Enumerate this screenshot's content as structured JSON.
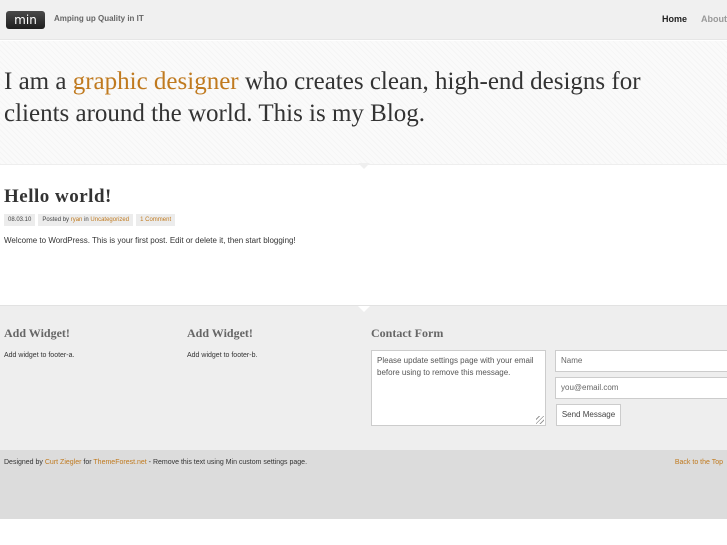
{
  "header": {
    "logo": "min",
    "tagline": "Amping up Quality in IT",
    "nav": [
      {
        "label": "Home",
        "active": true
      },
      {
        "label": "About",
        "active": false
      }
    ]
  },
  "hero": {
    "prefix": "I am a ",
    "highlight": "graphic designer",
    "suffix": " who creates clean, high-end designs for clients around the world. This is my Blog."
  },
  "post": {
    "title": "Hello world!",
    "date": "08.03.10",
    "posted_by_prefix": "Posted by",
    "author": "ryan",
    "in_label": "in",
    "category": "Uncategorized",
    "comments": "1 Comment",
    "body": "Welcome to WordPress. This is your first post. Edit or delete it, then start blogging!"
  },
  "footer_widgets": {
    "widget_a": {
      "title": "Add Widget!",
      "text": "Add widget to footer-a."
    },
    "widget_b": {
      "title": "Add Widget!",
      "text": "Add widget to footer-b."
    },
    "contact": {
      "title": "Contact Form",
      "message": "Please update settings page with your email before using to remove this message.",
      "name_placeholder": "Name",
      "email_placeholder": "you@email.com",
      "send_label": "Send Message"
    }
  },
  "bottom": {
    "designed_by": "Designed by",
    "designer": "Curt Ziegler",
    "for_label": "for",
    "site": "ThemeForest.net",
    "notice": " - Remove this text using Min custom settings page.",
    "back_to_top": "Back to the Top"
  },
  "colors": {
    "accent": "#c07a1f"
  }
}
